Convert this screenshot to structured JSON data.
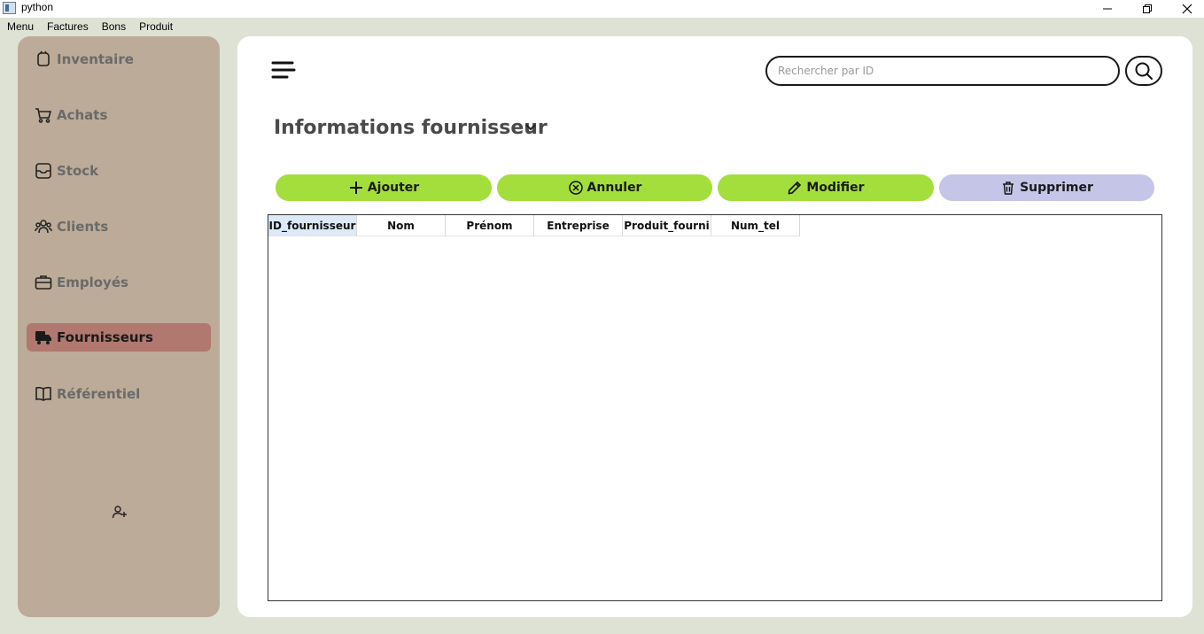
{
  "window": {
    "title": "python",
    "icon": "app-window-icon",
    "controls": [
      "minimize-icon",
      "restore-icon",
      "close-icon"
    ]
  },
  "menubar": {
    "items": [
      "Menu",
      "Factures",
      "Bons",
      "Produit"
    ]
  },
  "sidebar": {
    "items": [
      {
        "label": "Inventaire",
        "icon": "inventory-icon",
        "active": false
      },
      {
        "label": "Achats",
        "icon": "cart-icon",
        "active": false
      },
      {
        "label": "Stock",
        "icon": "stock-box-icon",
        "active": false
      },
      {
        "label": "Clients",
        "icon": "clients-icon",
        "active": false
      },
      {
        "label": "Employés",
        "icon": "briefcase-icon",
        "active": false
      },
      {
        "label": "Fournisseurs",
        "icon": "truck-icon",
        "active": true
      },
      {
        "label": "Référentiel",
        "icon": "book-icon",
        "active": false
      }
    ],
    "footer_icon": "add-user-icon"
  },
  "header": {
    "menu_icon": "hamburger-icon",
    "search": {
      "placeholder": "Rechercher par ID",
      "value": "",
      "icon": "search-icon"
    }
  },
  "main": {
    "title": "Informations fournisseur",
    "title_icon": "chevron-down-icon",
    "actions": [
      {
        "label": "Ajouter",
        "icon": "plus-icon",
        "color": "#a3de3c"
      },
      {
        "label": "Annuler",
        "icon": "cancel-circle-icon",
        "color": "#a3de3c"
      },
      {
        "label": "Modifier",
        "icon": "pencil-icon",
        "color": "#a3de3c"
      },
      {
        "label": "Supprimer",
        "icon": "trash-icon",
        "color": "#c5c5e8"
      }
    ],
    "table": {
      "columns": [
        "ID_fournisseur",
        "Nom",
        "Prénom",
        "Entreprise",
        "Produit_fourni",
        "Num_tel"
      ],
      "selected_column": "ID_fournisseur",
      "rows": []
    }
  },
  "colors": {
    "background": "#dde2d4",
    "sidebar": "#bcab98",
    "sidebar_active": "#b0786f",
    "button_green": "#a3de3c",
    "button_lavender": "#c5c5e8"
  }
}
